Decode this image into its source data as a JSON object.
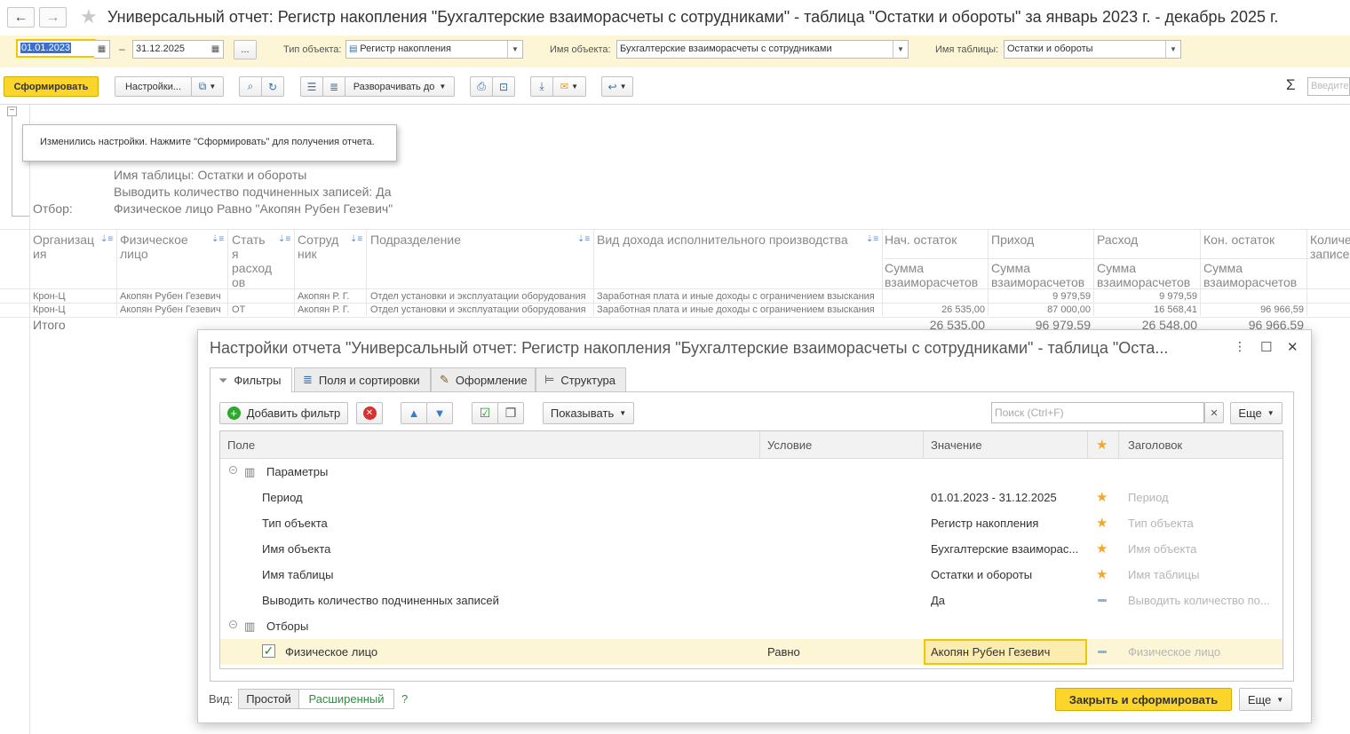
{
  "window": {
    "title": "Универсальный отчет: Регистр накопления \"Бухгалтерские взаиморасчеты с сотрудниками\" - таблица \"Остатки и обороты\" за январь 2023 г. - декабрь 2025 г.",
    "back_icon": "←",
    "forward_icon": "→",
    "star_icon": "★"
  },
  "params": {
    "date_from": "01.01.2023",
    "dash": "–",
    "date_to": "31.12.2025",
    "more_btn": "...",
    "object_type_label": "Тип объекта:",
    "object_type_value": "Регистр накопления",
    "object_name_label": "Имя объекта:",
    "object_name_value": "Бухгалтерские взаиморасчеты с сотрудниками",
    "table_name_label": "Имя таблицы:",
    "table_name_value": "Остатки и обороты"
  },
  "toolbar": {
    "generate": "Сформировать",
    "settings": "Настройки...",
    "expand_to": "Разворачивать до",
    "sigma": "Σ",
    "input_placeholder": "Введите"
  },
  "report": {
    "info_lines": [
      {
        "label": "",
        "value": "Имя таблицы: Остатки и обороты"
      },
      {
        "label": "",
        "value": "Выводить количество подчиненных записей: Да"
      },
      {
        "label": "Отбор:",
        "value": "Физическое лицо Равно \"Акопян Рубен Гезевич\""
      }
    ],
    "headers": {
      "org": "Организац ия",
      "person": "Физическое лицо",
      "article": "Стать я расход ов",
      "employee": "Сотруд ник",
      "department": "Подразделение",
      "income_type": "Вид дохода исполнительного производства",
      "start_balance": "Нач. остаток",
      "income": "Приход",
      "expense": "Расход",
      "end_balance": "Кон. остаток",
      "count": "Количе записе",
      "sum_label": "Сумма взаиморасчетов",
      "sort_icon": "⇣≡"
    },
    "rows": [
      {
        "org": "Крон-Ц",
        "person": "Акопян Рубен Гезевич",
        "article": "",
        "employee": "Акопян Р. Г.",
        "department": "Отдел установки и эксплуатации оборудования",
        "income_type": "Заработная плата и иные доходы с ограничением взыскания",
        "start": "",
        "income": "9 979,59",
        "expense": "9 979,59",
        "end": ""
      },
      {
        "org": "Крон-Ц",
        "person": "Акопян Рубен Гезевич",
        "article": "ОТ",
        "employee": "Акопян Р. Г.",
        "department": "Отдел установки и эксплуатации оборудования",
        "income_type": "Заработная плата и иные доходы с ограничением взыскания",
        "start": "26 535,00",
        "income": "87 000,00",
        "expense": "16 568,41",
        "end": "96 966,59"
      }
    ],
    "total": {
      "label": "Итого",
      "start": "26 535,00",
      "income": "96 979,59",
      "expense": "26 548,00",
      "end": "96 966,59"
    },
    "tooltip": "Изменились настройки. Нажмите \"Сформировать\" для получения отчета."
  },
  "dialog": {
    "title": "Настройки отчета \"Универсальный отчет: Регистр накопления \"Бухгалтерские взаиморасчеты с сотрудниками\" - таблица \"Оста...",
    "tabs": [
      "Фильтры",
      "Поля и сортировки",
      "Оформление",
      "Структура"
    ],
    "add_filter": "Добавить фильтр",
    "show": "Показывать",
    "search_placeholder": "Поиск (Ctrl+F)",
    "more": "Еще",
    "columns": {
      "field": "Поле",
      "condition": "Условие",
      "value": "Значение",
      "title": "Заголовок"
    },
    "groups": {
      "params": "Параметры",
      "filters": "Отборы"
    },
    "param_rows": [
      {
        "field": "Период",
        "value": "01.01.2023 - 31.12.2025",
        "title": "Период",
        "mark": "star"
      },
      {
        "field": "Тип объекта",
        "value": "Регистр накопления",
        "title": "Тип объекта",
        "mark": "star"
      },
      {
        "field": "Имя объекта",
        "value": "Бухгалтерские взаиморас...",
        "title": "Имя объекта",
        "mark": "star"
      },
      {
        "field": "Имя таблицы",
        "value": "Остатки и обороты",
        "title": "Имя таблицы",
        "mark": "star"
      },
      {
        "field": "Выводить количество подчиненных записей",
        "value": "Да",
        "title": "Выводить количество по...",
        "mark": "dash"
      }
    ],
    "filter_row": {
      "field": "Физическое лицо",
      "condition": "Равно",
      "value": "Акопян Рубен Гезевич",
      "title": "Физическое лицо",
      "checked": true
    },
    "view_label": "Вид:",
    "view_simple": "Простой",
    "view_advanced": "Расширенный",
    "help": "?",
    "close_generate": "Закрыть и сформировать",
    "more_bottom": "Еще"
  },
  "colors": {
    "accent": "#fbd52c",
    "highlight_row": "#fcf6d7"
  }
}
